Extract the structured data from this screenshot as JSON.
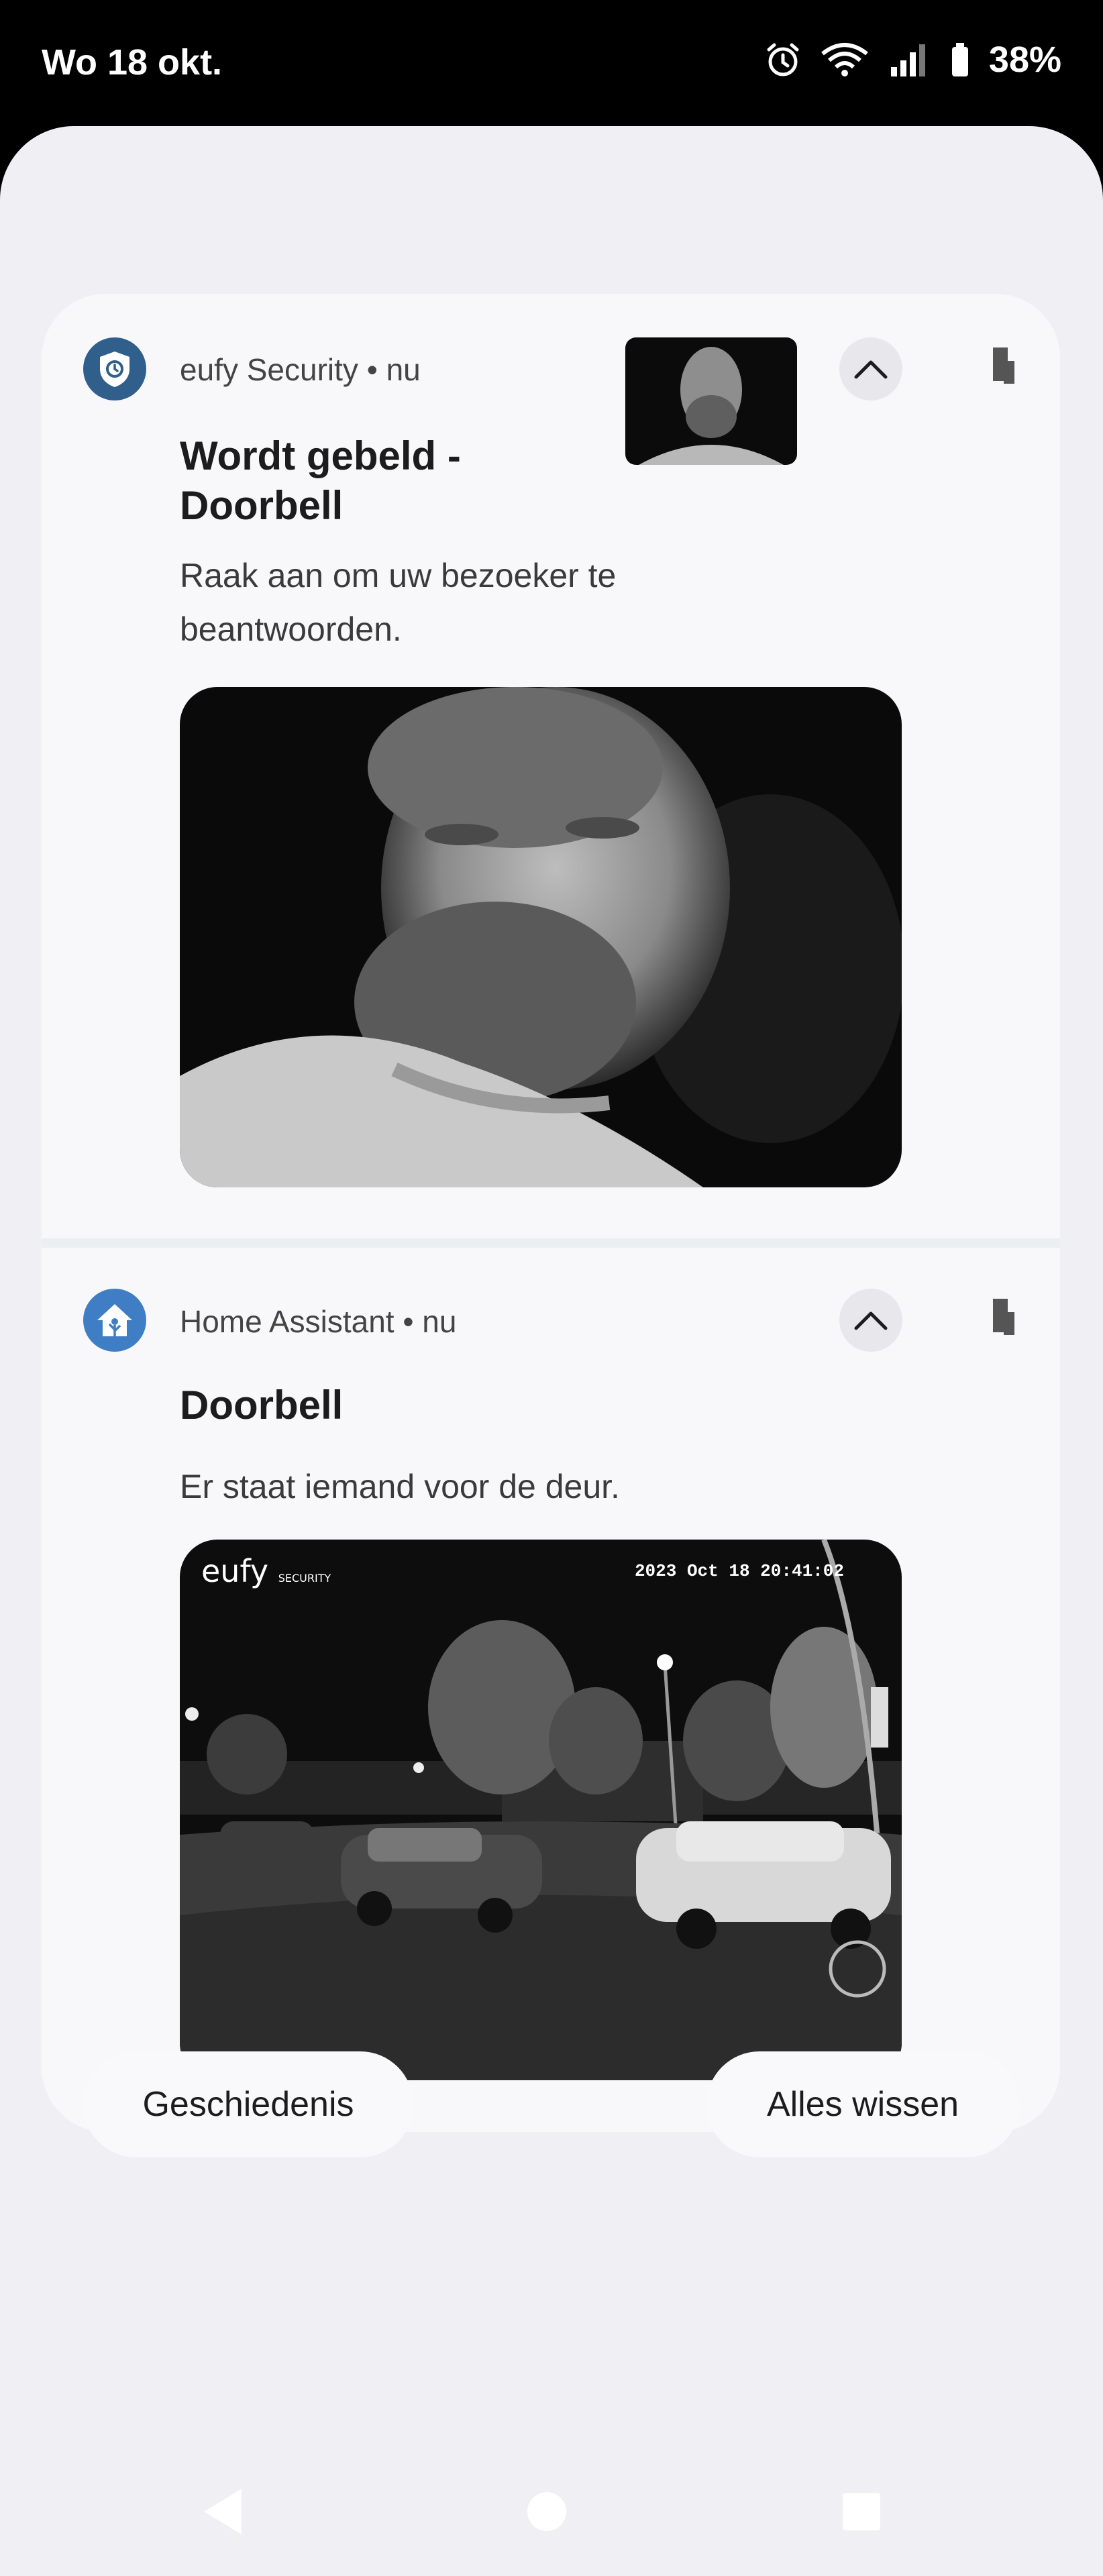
{
  "status_bar": {
    "date": "Wo 18 okt.",
    "battery": "38%",
    "icons": [
      "alarm-icon",
      "wifi-icon",
      "signal-icon",
      "battery-icon"
    ]
  },
  "notifications": [
    {
      "app": "eufy Security",
      "time": "nu",
      "title": "Wordt gebeld - Doorbell",
      "title_line1": "Wordt gebeld -",
      "title_line2": "Doorbell",
      "text": "Raak aan om uw bezoeker te beantwoorden.",
      "text_line1": "Raak aan om uw bezoeker te",
      "text_line2": "beantwoorden.",
      "icon": "shield-icon"
    },
    {
      "app": "Home Assistant",
      "time": "nu",
      "title": "Doorbell",
      "text": "Er staat iemand voor de deur.",
      "icon": "home-assistant-icon",
      "image_watermark": "eufy",
      "image_watermark_sub": "SECURITY",
      "image_timestamp": "2023 Oct 18 20:41:02"
    }
  ],
  "separator": "•",
  "actions": {
    "history": "Geschiedenis",
    "clear_all": "Alles wissen"
  },
  "colors": {
    "shade_bg": "#f0f0f4",
    "card_bg": "#f8f8fa",
    "eufy_icon": "#2f5f8a",
    "ha_icon": "#3f7ec4"
  }
}
